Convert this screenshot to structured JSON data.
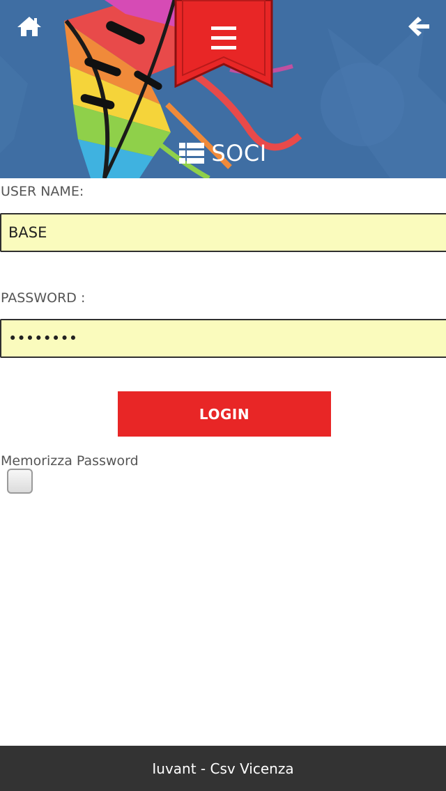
{
  "header": {
    "section_title": "SOCI",
    "icons": {
      "home": "home-icon",
      "back": "arrow-left-icon",
      "menu": "hamburger-menu-icon",
      "section": "list-icon"
    }
  },
  "form": {
    "username_label": "USER NAME:",
    "username_value": "BASE",
    "password_label": "PASSWORD :",
    "password_value": "12345678",
    "login_label": "LOGIN",
    "remember_label": "Memorizza Password",
    "remember_checked": false
  },
  "footer": {
    "text": "Iuvant - Csv Vicenza"
  },
  "colors": {
    "header_bg": "#3f6ea3",
    "accent_red": "#e82626",
    "input_bg": "#fafbbd",
    "footer_bg": "#333333"
  }
}
